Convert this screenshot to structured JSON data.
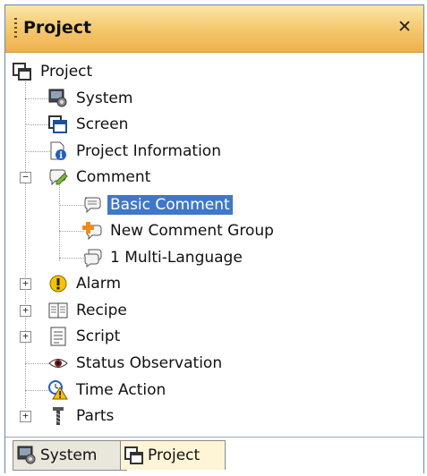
{
  "panel": {
    "title": "Project",
    "pin_glyph": "ᅟ⊥",
    "close_glyph": "✕"
  },
  "tree": {
    "root": "Project",
    "items": [
      {
        "label": "System",
        "icon": "system-icon"
      },
      {
        "label": "Screen",
        "icon": "screen-icon"
      },
      {
        "label": "Project Information",
        "icon": "info-icon"
      },
      {
        "label": "Comment",
        "icon": "comment-icon",
        "expanded": true,
        "children": [
          {
            "label": "Basic Comment",
            "icon": "comment-bubble-icon",
            "selected": true
          },
          {
            "label": "New Comment Group",
            "icon": "add-comment-icon"
          },
          {
            "label": "1 Multi-Language",
            "icon": "multi-language-icon"
          }
        ]
      },
      {
        "label": "Alarm",
        "icon": "alarm-icon",
        "collapsed": true
      },
      {
        "label": "Recipe",
        "icon": "recipe-icon",
        "collapsed": true
      },
      {
        "label": "Script",
        "icon": "script-icon",
        "collapsed": true
      },
      {
        "label": "Status Observation",
        "icon": "eye-icon"
      },
      {
        "label": "Time Action",
        "icon": "time-action-icon"
      },
      {
        "label": "Parts",
        "icon": "parts-icon",
        "collapsed": true
      }
    ]
  },
  "tabs": [
    {
      "label": "System",
      "icon": "system-icon"
    },
    {
      "label": "Project",
      "icon": "project-icon",
      "active": true
    }
  ]
}
